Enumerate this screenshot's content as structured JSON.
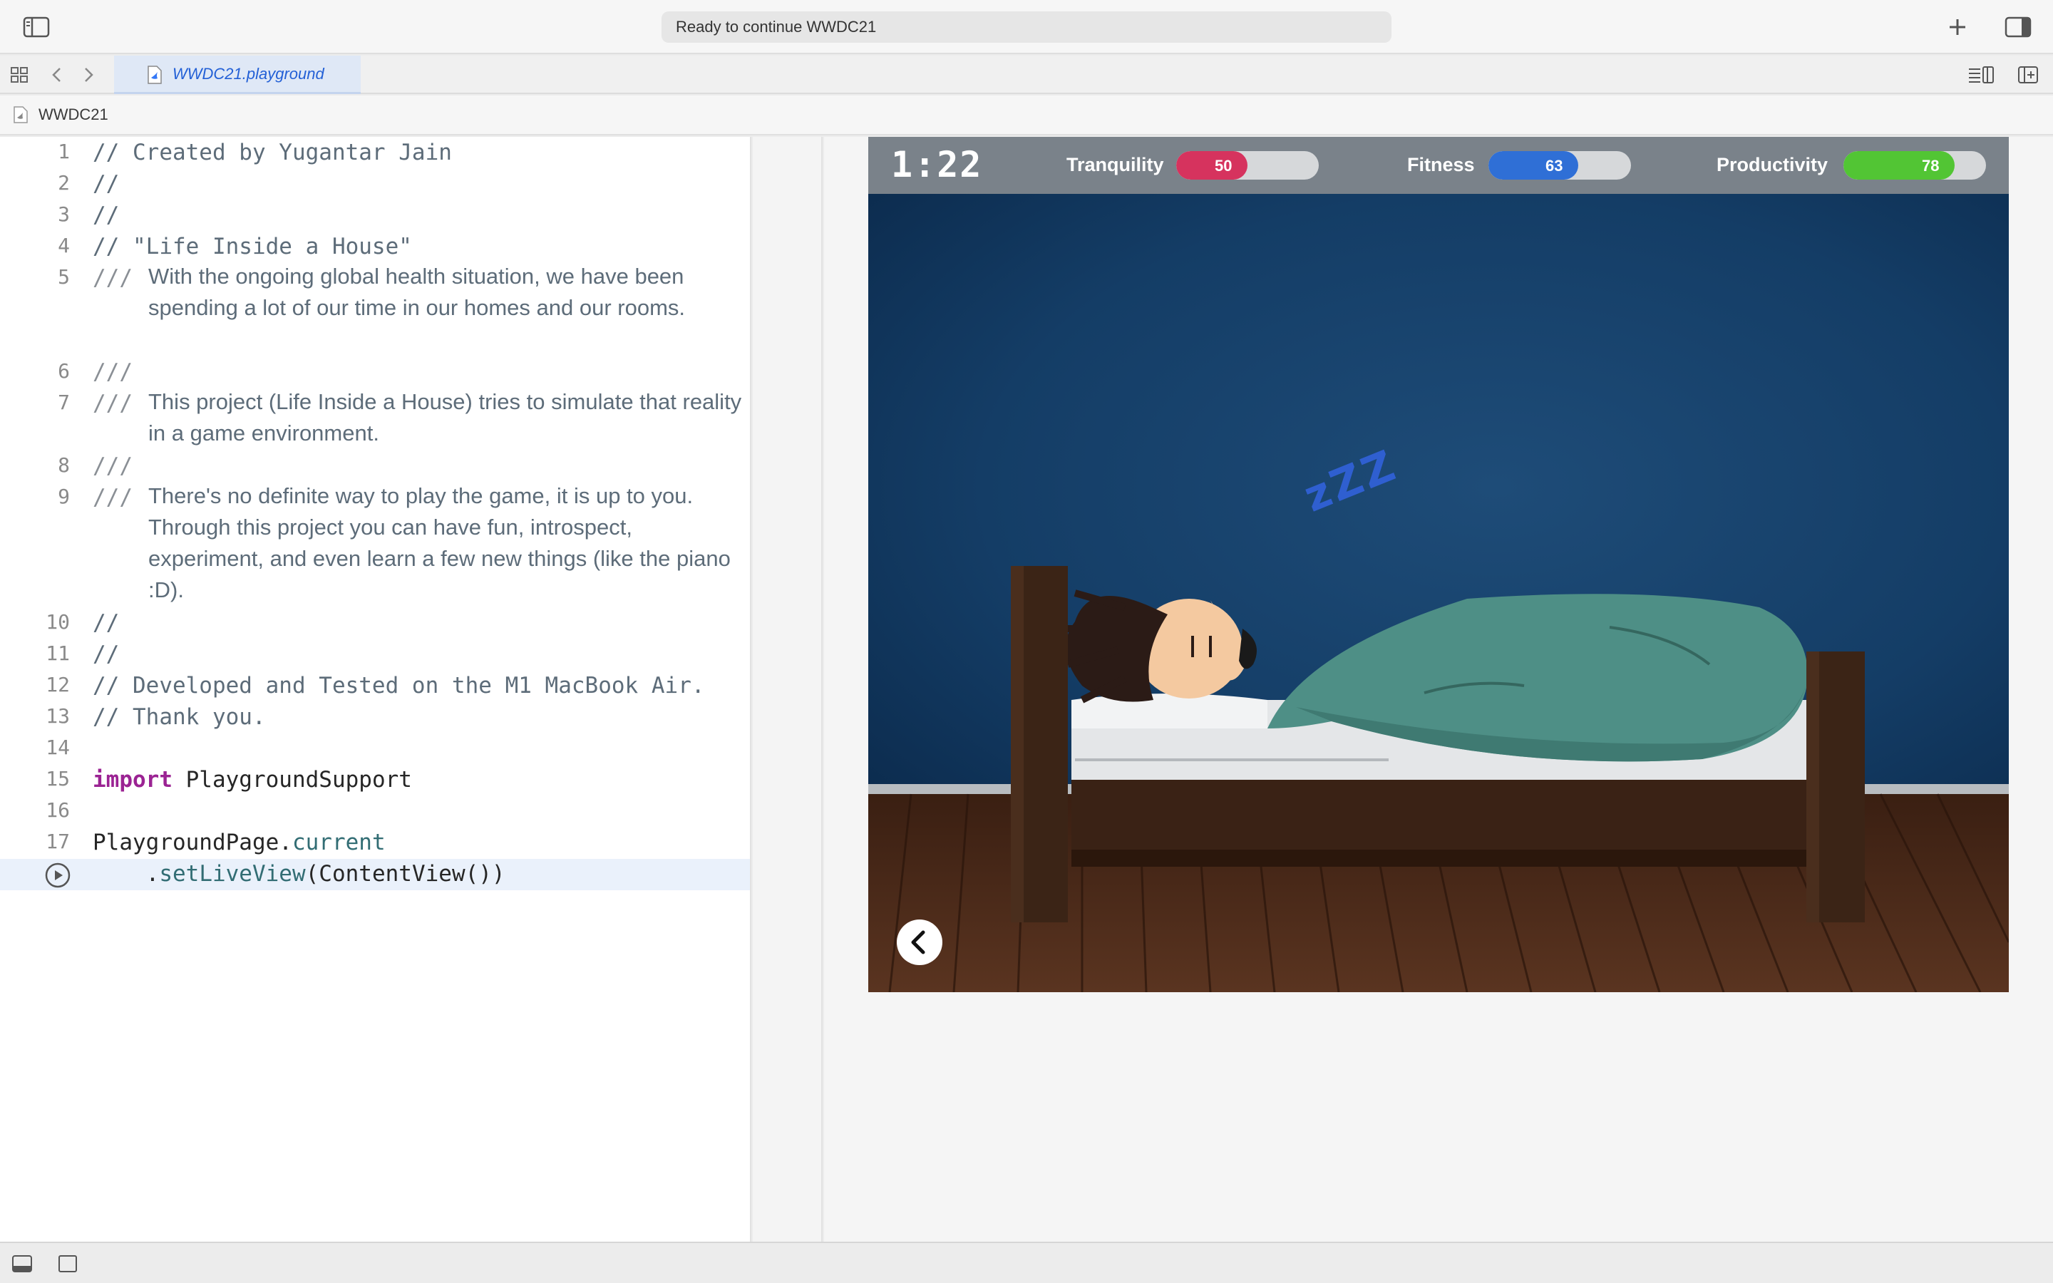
{
  "window": {
    "activity_text": "Ready to continue WWDC21"
  },
  "tab": {
    "label": "WWDC21.playground"
  },
  "breadcrumb": {
    "label": "WWDC21"
  },
  "editor": {
    "lines": [
      {
        "n": "1",
        "text": "// Created by Yugantar Jain"
      },
      {
        "n": "2",
        "text": "//"
      },
      {
        "n": "3",
        "text": "//"
      },
      {
        "n": "4",
        "text": "// \"Life Inside a House\""
      },
      {
        "n": "5",
        "prefix": "///",
        "doc": "With the ongoing global health situation, we have been spending a lot of our time in our homes and our rooms."
      },
      {
        "n": "6",
        "prefix": "///"
      },
      {
        "n": "7",
        "prefix": "///",
        "doc": "This project (Life Inside a House) tries to simulate that reality in a game environment."
      },
      {
        "n": "8",
        "prefix": "///"
      },
      {
        "n": "9",
        "prefix": "///",
        "doc": "There's no definite way to play the game, it is up to you. Through this project you can have fun, introspect, experiment, and even learn a few new things (like the piano :D)."
      },
      {
        "n": "10",
        "text": "//"
      },
      {
        "n": "11",
        "text": "//"
      },
      {
        "n": "12",
        "text": "// Developed and Tested on the M1 MacBook Air."
      },
      {
        "n": "13",
        "text": "// Thank you."
      },
      {
        "n": "14",
        "text": ""
      },
      {
        "n": "15",
        "keyword": "import",
        "rest": " PlaygroundSupport"
      },
      {
        "n": "16",
        "text": ""
      },
      {
        "n": "17",
        "a": "PlaygroundPage.",
        "b": "current",
        "c": "    .",
        "d": "setLiveView",
        "e": "(ContentView())"
      }
    ]
  },
  "game": {
    "timer": "1:22",
    "stats": [
      {
        "label": "Tranquility",
        "value": 50,
        "color": "#d6335e"
      },
      {
        "label": "Fitness",
        "value": 63,
        "color": "#2f6fd6"
      },
      {
        "label": "Productivity",
        "value": 78,
        "color": "#52c534"
      }
    ],
    "sleep_text": "zZZ"
  },
  "icons": [
    "sidebar-left-icon",
    "add-icon",
    "sidebar-right-icon",
    "grid-icon",
    "chevron-left-icon",
    "chevron-right-icon",
    "swift-file-icon",
    "editor-options-icon",
    "add-editor-icon",
    "run-icon",
    "back-arrow-icon",
    "debug-area-icon",
    "console-icon"
  ]
}
